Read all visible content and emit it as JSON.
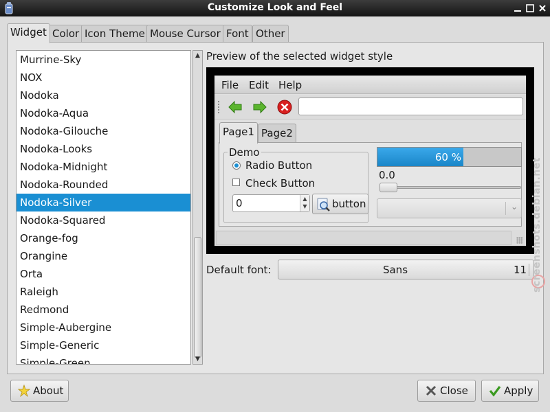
{
  "window": {
    "title": "Customize Look and Feel"
  },
  "tabs": [
    "Widget",
    "Color",
    "Icon Theme",
    "Mouse Cursor",
    "Font",
    "Other"
  ],
  "theme_list": {
    "items": [
      "Murrine-Sky",
      "NOX",
      "Nodoka",
      "Nodoka-Aqua",
      "Nodoka-Gilouche",
      "Nodoka-Looks",
      "Nodoka-Midnight",
      "Nodoka-Rounded",
      "Nodoka-Silver",
      "Nodoka-Squared",
      "Orange-fog",
      "Orangine",
      "Orta",
      "Raleigh",
      "Redmond",
      "Simple-Aubergine",
      "Simple-Generic",
      "Simple-Green"
    ],
    "selected": "Nodoka-Silver"
  },
  "preview": {
    "label": "Preview of the selected widget style",
    "menu": [
      "File",
      "Edit",
      "Help"
    ],
    "toolbar_icons": [
      "back-arrow-icon",
      "forward-arrow-icon",
      "stop-icon"
    ],
    "entry_value": "",
    "tabs": [
      "Page1",
      "Page2"
    ],
    "frame_label": "Demo",
    "radio_label": "Radio Button",
    "radio_checked": true,
    "check_label": "Check Button",
    "check_checked": false,
    "spin_value": "0",
    "button_label": "button",
    "progress_text": "60 %",
    "progress_fraction": 0.6,
    "scale_value": "0.0",
    "combo_value": ""
  },
  "font": {
    "label": "Default font:",
    "name": "Sans",
    "size": "11"
  },
  "buttons": {
    "about": "About",
    "close": "Close",
    "apply": "Apply"
  },
  "watermark": "screenshots.debian.net",
  "colors": {
    "selection": "#1a8fd3",
    "progress": "#2a9ada",
    "titlebar": "#262626"
  }
}
